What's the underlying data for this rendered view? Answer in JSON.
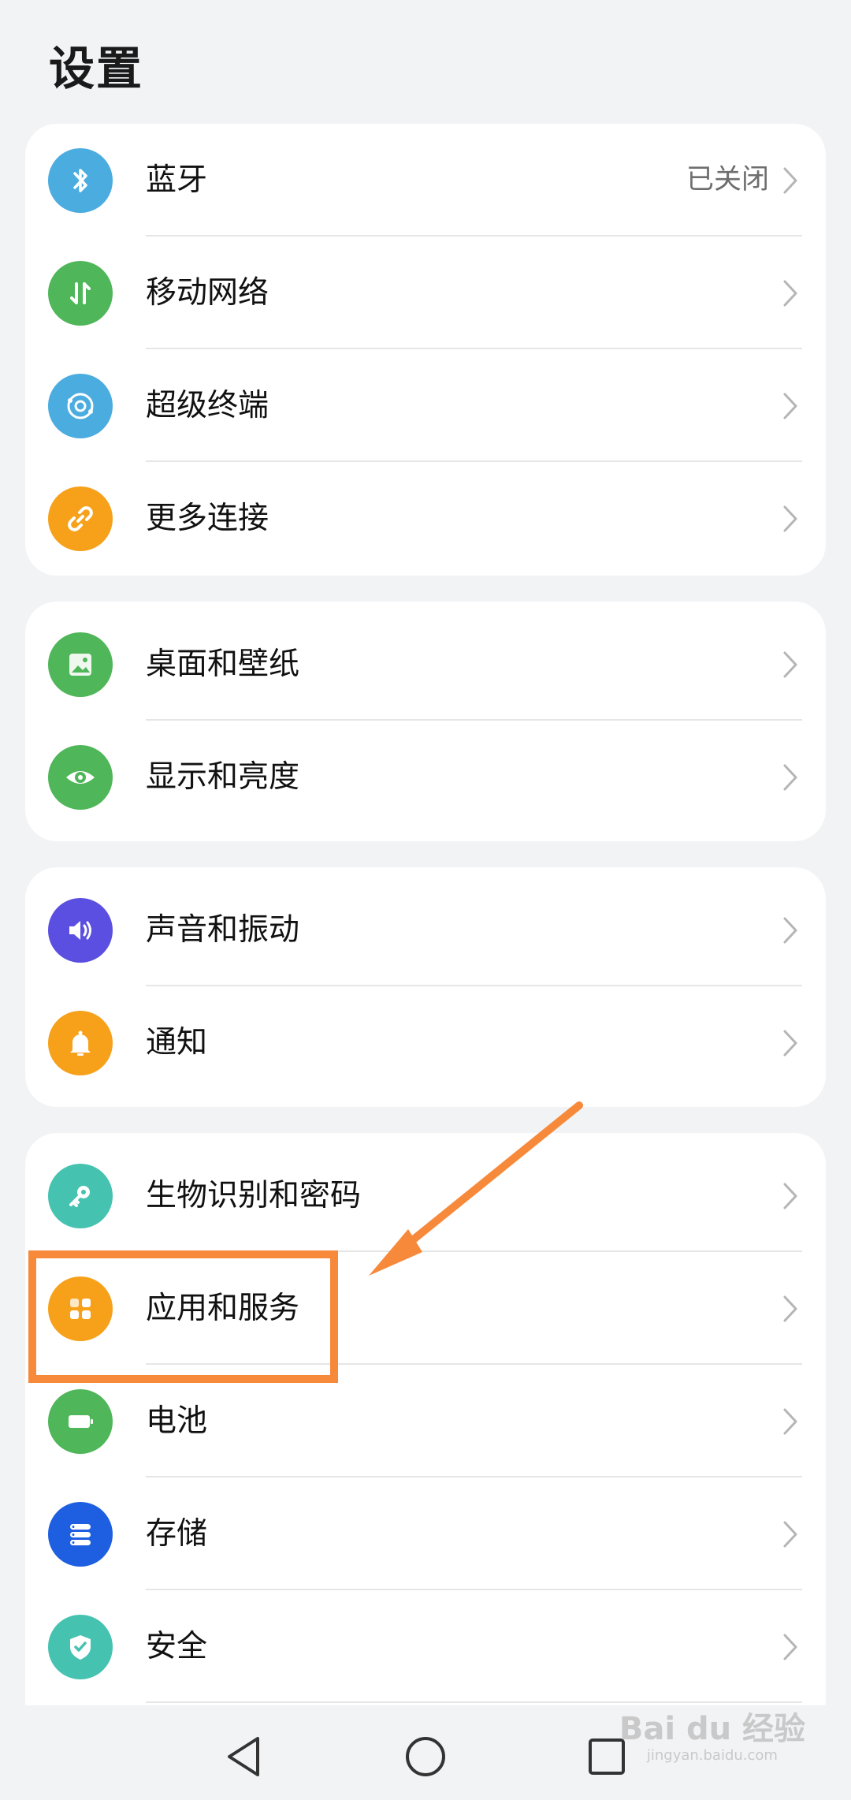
{
  "page_title": "设置",
  "sections": [
    {
      "items": [
        {
          "label": "蓝牙",
          "value": "已关闭",
          "icon": "bluetooth-icon",
          "color": "#4bace0"
        },
        {
          "label": "移动网络",
          "value": "",
          "icon": "mobile-data-icon",
          "color": "#4fb659"
        },
        {
          "label": "超级终端",
          "value": "",
          "icon": "super-device-icon",
          "color": "#4bace0"
        },
        {
          "label": "更多连接",
          "value": "",
          "icon": "link-icon",
          "color": "#f7a11b"
        }
      ]
    },
    {
      "items": [
        {
          "label": "桌面和壁纸",
          "icon": "wallpaper-icon",
          "color": "#4fb659"
        },
        {
          "label": "显示和亮度",
          "icon": "eye-icon",
          "color": "#4fb659"
        }
      ]
    },
    {
      "items": [
        {
          "label": "声音和振动",
          "icon": "speaker-icon",
          "color": "#5a4fe0"
        },
        {
          "label": "通知",
          "icon": "bell-icon",
          "color": "#f7a11b"
        }
      ]
    },
    {
      "items": [
        {
          "label": "生物识别和密码",
          "icon": "key-icon",
          "color": "#45c2b0"
        },
        {
          "label": "应用和服务",
          "icon": "apps-icon",
          "color": "#f7a11b"
        },
        {
          "label": "电池",
          "icon": "battery-icon",
          "color": "#4fb659"
        },
        {
          "label": "存储",
          "icon": "storage-icon",
          "color": "#1d5fe0"
        },
        {
          "label": "安全",
          "icon": "shield-icon",
          "color": "#45c2b0"
        }
      ]
    }
  ],
  "annotation": {
    "highlighted_item": "应用和服务",
    "color": "#f7893a"
  },
  "navbar": {
    "back": "back-icon",
    "home": "home-icon",
    "recents": "recents-icon"
  },
  "watermark": {
    "brand": "Bai du 经验",
    "url": "jingyan.baidu.com"
  }
}
